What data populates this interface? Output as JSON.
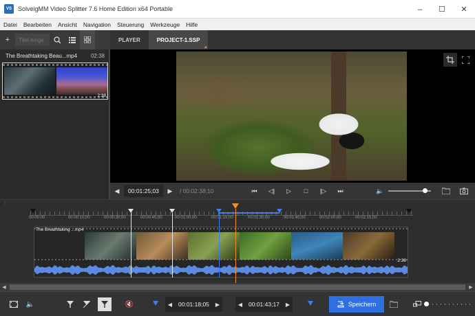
{
  "window": {
    "title": "SolveigMM Video Splitter 7.6 Home Edition x64 Portable",
    "app_icon_label": "VS",
    "minimize": "–",
    "maximize": "☐",
    "close": "✕"
  },
  "menu": [
    "Datei",
    "Bearbeiten",
    "Ansicht",
    "Navigation",
    "Steuerung",
    "Werkzeuge",
    "Hilfe"
  ],
  "left_toolbar": {
    "search_placeholder": "Titel einge"
  },
  "tabs": [
    {
      "label": "PLAYER",
      "active": false
    },
    {
      "label": "PROJECT-1.SSP",
      "active": true
    }
  ],
  "media": {
    "name": "The Breathtaking Beau...mp4",
    "duration": "02:38",
    "thumb_duration": "2:38"
  },
  "player": {
    "current_time": "00:01:25;03",
    "total_time": "/ 00:02:38;10",
    "volume_level": 0.85
  },
  "timeline": {
    "ticks": [
      "00:00:00",
      "00:00:15;00",
      "00:00:30;00",
      "00:00:45;00",
      "00:01:00;00",
      "00:01:15;00",
      "00:01:30;00",
      "00:01:45;00",
      "00:02:00;00",
      "00:02:15;00"
    ],
    "track_label": "The Breathtaking ...mp4",
    "track_duration": "2:38"
  },
  "bottom": {
    "start_time": "00:01:18;05",
    "end_time": "00:01:43;17",
    "save_label": "Speichern",
    "zoom_level": 0.0
  },
  "colors": {
    "accent": "#2f6fe0",
    "marker_orange": "#f0902a",
    "marker_blue": "#3d7ff0",
    "waveform": "#5b8be0"
  }
}
